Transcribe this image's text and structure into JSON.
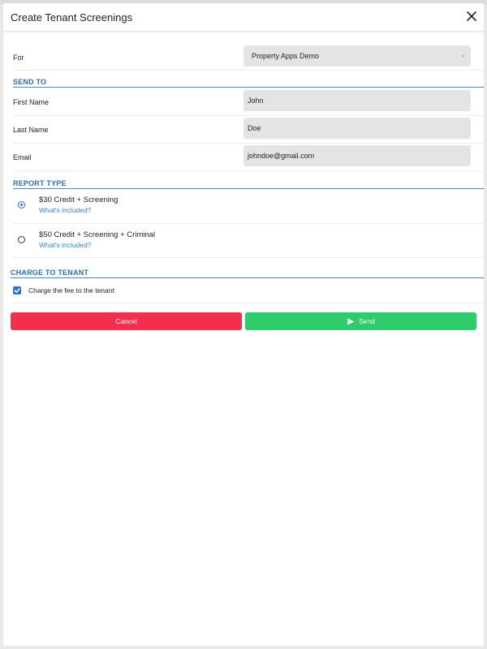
{
  "header": {
    "title": "Create Tenant Screenings"
  },
  "form": {
    "for_label": "For",
    "for_value": "Property Apps Demo",
    "send_to": {
      "section_title": "SEND TO",
      "first_name_label": "First Name",
      "first_name_value": "John",
      "last_name_label": "Last Name",
      "last_name_value": "Doe",
      "email_label": "Email",
      "email_value": "johndoe@gmail.com"
    },
    "report_type": {
      "section_title": "REPORT TYPE",
      "options": [
        {
          "title": "$30 Credit + Screening",
          "link": "What's included?",
          "selected": true
        },
        {
          "title": "$50 Credit + Screening + Criminal",
          "link": "What's included?",
          "selected": false
        }
      ]
    },
    "charge": {
      "section_title": "CHARGE TO TENANT",
      "checkbox_label": "Charge the fee to the tenant",
      "checked": true
    }
  },
  "actions": {
    "cancel_label": "Cancel",
    "send_label": "Send"
  },
  "colors": {
    "accent_blue": "#2c6fb0",
    "link_blue": "#3b82d1",
    "cancel_red": "#f2304e",
    "send_green": "#2ecc6a",
    "field_gray": "#e4e4e4"
  },
  "icons": {
    "close": "close-icon",
    "send": "paper-plane-icon",
    "dropdown": "chevron-down-icon",
    "checkbox": "checkmark-icon"
  }
}
